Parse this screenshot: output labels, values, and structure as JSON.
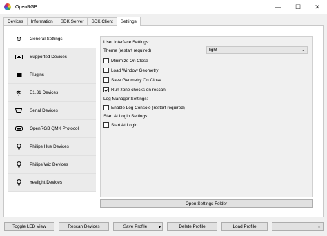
{
  "window": {
    "title": "OpenRGB",
    "minimize": "—",
    "maximize": "☐",
    "close": "✕"
  },
  "tabs": [
    {
      "label": "Devices"
    },
    {
      "label": "Information"
    },
    {
      "label": "SDK Server"
    },
    {
      "label": "SDK Client"
    },
    {
      "label": "Settings",
      "active": true
    }
  ],
  "sidebar": {
    "items": [
      {
        "label": "General Settings",
        "icon": "gear-icon",
        "active": true
      },
      {
        "label": "Supported Devices",
        "icon": "keyboard-icon"
      },
      {
        "label": "Plugins",
        "icon": "plug-icon"
      },
      {
        "label": "E1.31 Devices",
        "icon": "wifi-icon"
      },
      {
        "label": "Serial Devices",
        "icon": "serial-port-icon"
      },
      {
        "label": "OpenRGB QMK Protocol",
        "icon": "qmk-keyboard-icon"
      },
      {
        "label": "Philips Hue Devices",
        "icon": "lightbulb-icon"
      },
      {
        "label": "Philips Wiz Devices",
        "icon": "lightbulb-icon"
      },
      {
        "label": "Yeelight Devices",
        "icon": "lightbulb-icon"
      }
    ]
  },
  "settings": {
    "ui_header": "User Interface Settings:",
    "theme_label": "Theme (restart required)",
    "theme_value": "light",
    "minimize_on_close": {
      "label": "Minimize On Close",
      "checked": false
    },
    "load_window_geometry": {
      "label": "Load Window Geometry",
      "checked": false
    },
    "save_geometry_on_close": {
      "label": "Save Geometry On Close",
      "checked": false
    },
    "run_zone_checks": {
      "label": "Run zone checks on rescan",
      "checked": true
    },
    "log_header": "Log Manager Settings:",
    "enable_log_console": {
      "label": "Enable Log Console (restart required)",
      "checked": false
    },
    "start_header": "Start At Login Settings:",
    "start_at_login": {
      "label": "Start At Login",
      "checked": false
    },
    "open_folder_label": "Open Settings Folder"
  },
  "bottom_bar": {
    "toggle_led_view": "Toggle LED View",
    "rescan_devices": "Rescan Devices",
    "save_profile": "Save Profile",
    "delete_profile": "Delete Profile",
    "load_profile": "Load Profile",
    "profile_select_value": ""
  }
}
